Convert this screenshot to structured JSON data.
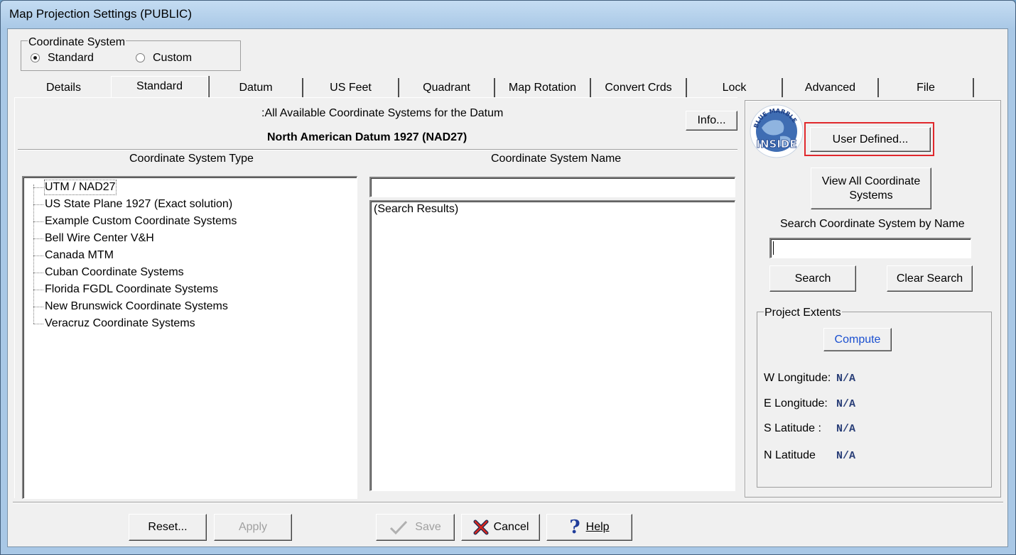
{
  "window": {
    "title": "Map Projection Settings (PUBLIC)"
  },
  "coord_system": {
    "legend": "Coordinate System",
    "options": [
      {
        "label": "Standard",
        "selected": true
      },
      {
        "label": "Custom",
        "selected": false
      }
    ]
  },
  "tabs": [
    {
      "label": "Details",
      "active": false
    },
    {
      "label": "Standard",
      "active": true
    },
    {
      "label": "Datum",
      "active": false
    },
    {
      "label": "US Feet",
      "active": false
    },
    {
      "label": "Quadrant",
      "active": false
    },
    {
      "label": "Map Rotation",
      "active": false
    },
    {
      "label": "Convert Crds",
      "active": false
    },
    {
      "label": "Lock",
      "active": false
    },
    {
      "label": "Advanced",
      "active": false
    },
    {
      "label": "File",
      "active": false
    }
  ],
  "main": {
    "available_label": ":All Available Coordinate Systems for the Datum",
    "datum_name": "North American Datum 1927 (NAD27)",
    "info_button": "Info...",
    "type_header": "Coordinate System Type",
    "name_header": "Coordinate System Name",
    "name_filter_value": "",
    "search_results_label": "(Search Results)",
    "tree_items": [
      "UTM / NAD27",
      "US State Plane 1927 (Exact solution)",
      "Example Custom Coordinate Systems",
      "Bell Wire Center V&H",
      "Canada MTM",
      "Cuban Coordinate Systems",
      "Florida FGDL Coordinate Systems",
      "New Brunswick Coordinate Systems",
      "Veracruz Coordinate Systems"
    ]
  },
  "right": {
    "logo_text": "BLUE MARBLE INSIDE",
    "user_defined_button": "User Defined...",
    "view_all_line1": "View All Coordinate",
    "view_all_line2": "Systems",
    "search_label": "Search Coordinate System by Name",
    "search_value": "",
    "search_button": "Search",
    "clear_search_button": "Clear Search",
    "extents": {
      "legend": "Project Extents",
      "compute_button": "Compute",
      "rows": [
        {
          "label": "W Longitude:",
          "value": "N/A"
        },
        {
          "label": "E Longitude:",
          "value": "N/A"
        },
        {
          "label": "S Latitude :",
          "value": "N/A"
        },
        {
          "label": "N Latitude",
          "value": "N/A"
        }
      ]
    }
  },
  "footer": {
    "reset": "Reset...",
    "apply": "Apply",
    "save": "Save",
    "cancel": "Cancel",
    "help": "Help"
  },
  "colors": {
    "highlight_border": "#e0282c",
    "compute_text": "#1a4fd0",
    "extent_value": "#2a3f78"
  }
}
